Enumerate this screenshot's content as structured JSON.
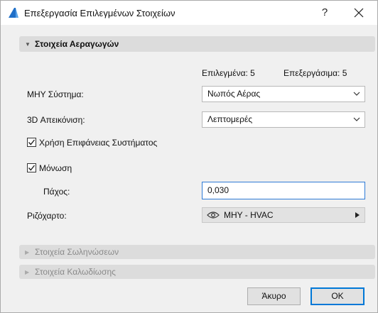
{
  "window": {
    "title": "Επεξεργασία Επιλεγμένων Στοιχείων",
    "help_label": "?",
    "close_icon": "close-icon"
  },
  "sections": {
    "ducts": {
      "title": "Στοιχεία Αεραγωγών",
      "selected_text": "Επιλεγμένα: 5",
      "editable_text": "Επεξεργάσιμα: 5",
      "mep_system_label": "ΜΗΥ Σύστημα:",
      "mep_system_value": "Νωπός Αέρας",
      "display_3d_label": "3D Απεικόνιση:",
      "display_3d_value": "Λεπτομερές",
      "use_system_surface_label": "Χρήση Επιφάνειας Συστήματος",
      "use_system_surface_checked": true,
      "insulation_label": "Μόνωση",
      "insulation_checked": true,
      "thickness_label": "Πάχος:",
      "thickness_value": "0,030",
      "layer_label": "Ριζόχαρτο:",
      "layer_value": "ΜΗΥ - HVAC",
      "layer_icon": "eye-icon"
    },
    "pipes": {
      "title": "Στοιχεία Σωληνώσεων"
    },
    "cables": {
      "title": "Στοιχεία Καλωδίωσης"
    }
  },
  "buttons": {
    "cancel_label": "Άκυρο",
    "ok_label": "OK"
  },
  "colors": {
    "accent": "#0078d7",
    "focus_border": "#2e7bd6",
    "section_header_bg": "#dcdcdc"
  }
}
